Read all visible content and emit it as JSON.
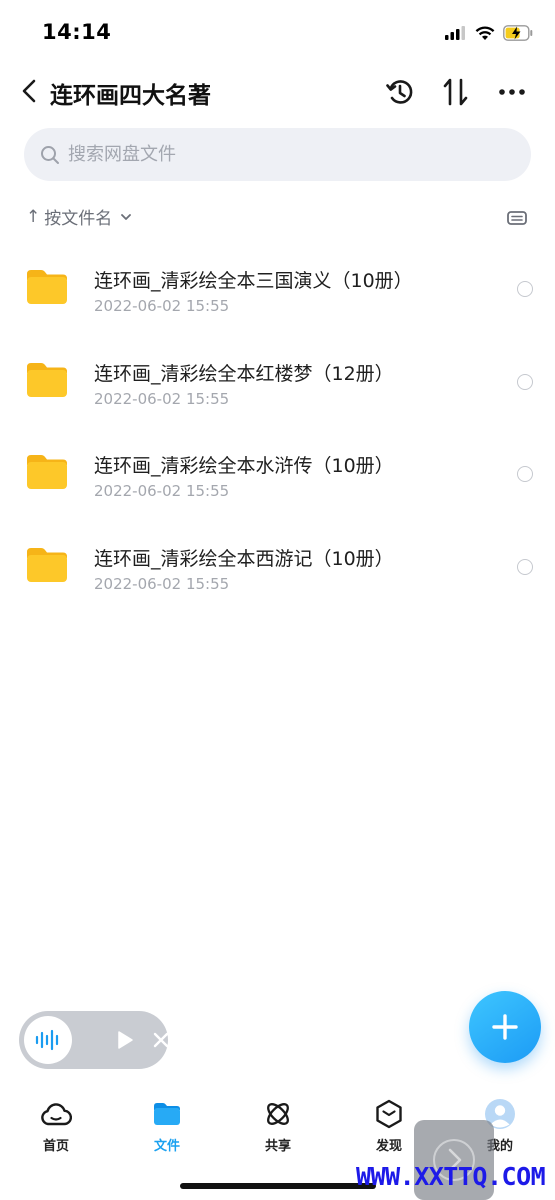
{
  "status_bar": {
    "time": "14:14",
    "icons": [
      "signal-icon",
      "wifi-icon",
      "battery-charging-icon"
    ]
  },
  "nav": {
    "back_icon": "chevron-left-icon",
    "title": "连环画四大名著",
    "actions": [
      "history-icon",
      "sort-icon",
      "more-icon"
    ]
  },
  "search": {
    "placeholder": "搜索网盘文件",
    "value": ""
  },
  "sort": {
    "arrow": "↑",
    "label": "按文件名",
    "dropdown_icon": "chevron-down-icon",
    "view_icon": "view-toggle-icon"
  },
  "files": [
    {
      "name": "连环画_清彩绘全本三国演义（10册）",
      "date": "2022-06-02 15:55",
      "icon": "folder-icon"
    },
    {
      "name": "连环画_清彩绘全本红楼梦（12册）",
      "date": "2022-06-02 15:55",
      "icon": "folder-icon"
    },
    {
      "name": "连环画_清彩绘全本水浒传（10册）",
      "date": "2022-06-02 15:55",
      "icon": "folder-icon"
    },
    {
      "name": "连环画_清彩绘全本西游记（10册）",
      "date": "2022-06-02 15:55",
      "icon": "folder-icon"
    }
  ],
  "audio_player": {
    "icons": [
      "sound-wave-icon",
      "play-icon",
      "close-icon"
    ]
  },
  "fab": {
    "icon": "plus-icon"
  },
  "tabs": [
    {
      "label": "首页",
      "icon": "cloud-icon",
      "active": false
    },
    {
      "label": "文件",
      "icon": "folder-icon",
      "active": true
    },
    {
      "label": "共享",
      "icon": "atom-icon",
      "active": false
    },
    {
      "label": "发现",
      "icon": "cube-icon",
      "active": false
    },
    {
      "label": "我的",
      "icon": "avatar-icon",
      "active": false
    }
  ],
  "watermark": "WWW.XXTTQ.COM",
  "colors": {
    "accent": "#1aa1f0",
    "folder": "#fdc829",
    "search_bg": "#eef0f5",
    "secondary_text": "#a4a7ae"
  }
}
